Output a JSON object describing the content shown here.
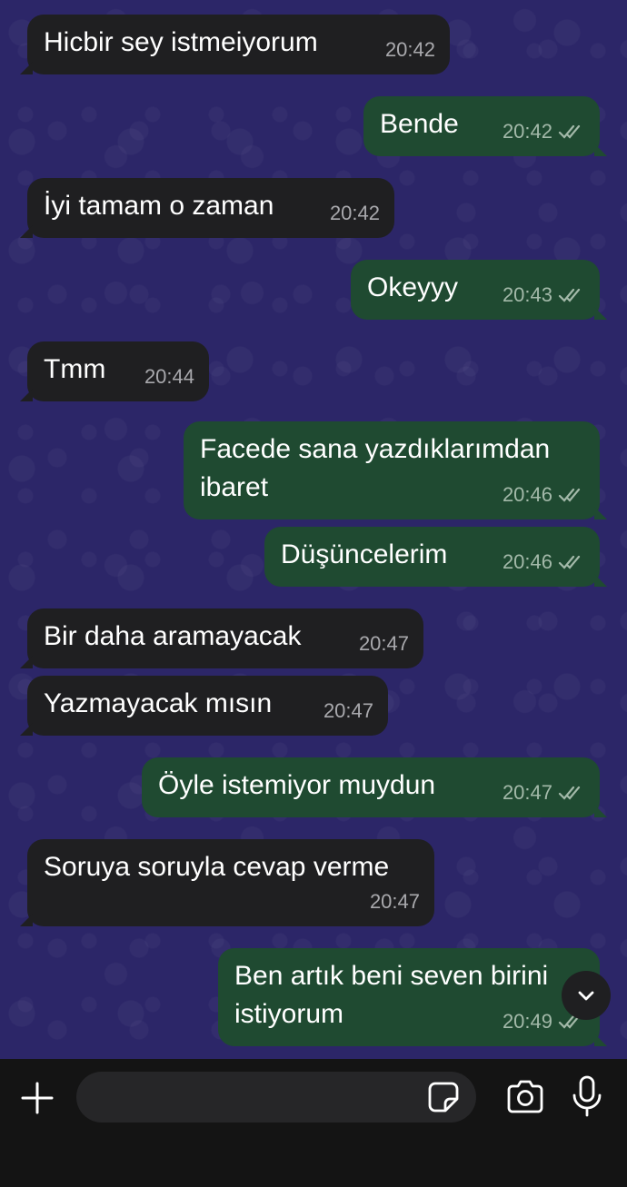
{
  "messages": [
    {
      "dir": "in",
      "text": "Hicbir sey istmeiyorum",
      "time": "20:42"
    },
    {
      "dir": "out",
      "text": "Bende",
      "time": "20:42"
    },
    {
      "dir": "in",
      "text": "İyi tamam o zaman",
      "time": "20:42"
    },
    {
      "dir": "out",
      "text": "Okeyyy",
      "time": "20:43"
    },
    {
      "dir": "in",
      "text": "Tmm",
      "time": "20:44"
    },
    {
      "dir": "out",
      "text": "Facede sana yazdıklarımdan ibaret",
      "time": "20:46"
    },
    {
      "dir": "out",
      "text": "Düşüncelerim",
      "time": "20:46"
    },
    {
      "dir": "in",
      "text": "Bir daha aramayacak",
      "time": "20:47"
    },
    {
      "dir": "in",
      "text": "Yazmayacak mısın",
      "time": "20:47"
    },
    {
      "dir": "out",
      "text": "Öyle istemiyor muydun",
      "time": "20:47"
    },
    {
      "dir": "in",
      "text": "Soruya soruyla cevap verme",
      "time": "20:47"
    },
    {
      "dir": "out",
      "text": "Ben artık beni seven birini istiyorum",
      "time": "20:49"
    }
  ],
  "composer": {
    "placeholder": "",
    "value": ""
  },
  "icons": {
    "plus": "plus-icon",
    "sticker": "sticker-icon",
    "camera": "camera-icon",
    "mic": "microphone-icon",
    "scroll": "chevron-down-icon",
    "read": "double-check-icon"
  },
  "colors": {
    "incoming": "#1f1f21",
    "outgoing": "#1f4a31",
    "wallpaper": "#2c2668",
    "bar": "#141414"
  }
}
